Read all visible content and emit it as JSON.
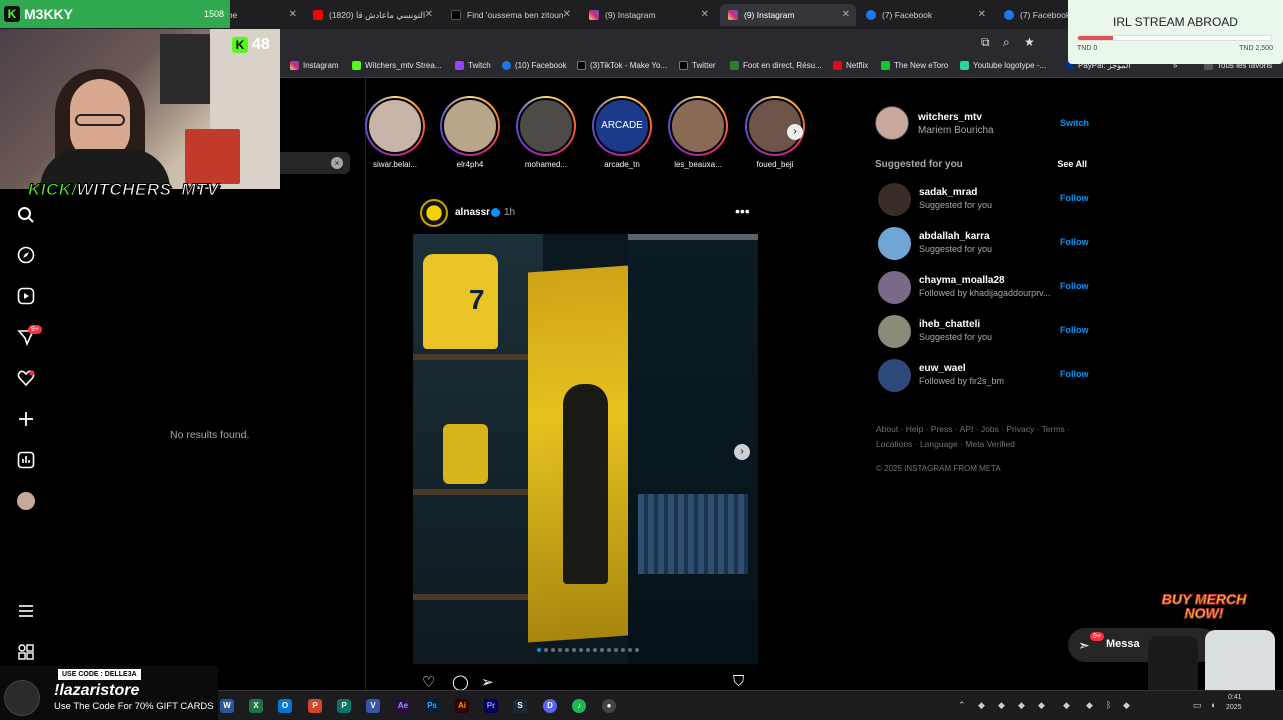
{
  "overlay": {
    "streamer_name": "M3KKY",
    "sub_count": "1508",
    "viewers": "48",
    "kick_logo": "K",
    "kick_handle_prefix": "KICK/",
    "kick_handle": "WITCHERS_MTV"
  },
  "tabs": [
    {
      "label": "ube",
      "active": false
    },
    {
      "label": "(1820) التونسي ماعادش قا",
      "active": false
    },
    {
      "label": "Find 'oussema ben zitoun",
      "active": false
    },
    {
      "label": "(9) Instagram",
      "active": false
    },
    {
      "label": "(9) Instagram",
      "active": true
    },
    {
      "label": "(7) Facebook",
      "active": false
    },
    {
      "label": "(7) Facebook",
      "active": false
    }
  ],
  "bookmarks": [
    "Instagram",
    "Witchers_mtv Strea...",
    "Twitch",
    "(10) Facebook",
    "(3)TikTok - Make Yo...",
    "Twitter",
    "Foot en direct, Résu...",
    "Netflix",
    "The New eToro",
    "Youtube logotype -...",
    "PayPal: الموجز",
    "Tous les favoris"
  ],
  "search": {
    "no_results": "No results found.",
    "clear_icon": "×"
  },
  "nav_badge": "9+",
  "stories": [
    {
      "name": "siwar.belai..."
    },
    {
      "name": "elr4ph4"
    },
    {
      "name": "mohamed..."
    },
    {
      "name": "arcade_tn"
    },
    {
      "name": "les_beauxa..."
    },
    {
      "name": "foued_beji"
    }
  ],
  "arcade_text": "ARCADE",
  "post": {
    "username": "alnassr",
    "time": "1h",
    "more": "•••",
    "jersey_number": "7"
  },
  "me": {
    "username": "witchers_mtv",
    "name": "Mariem Bouricha",
    "switch": "Switch"
  },
  "suggested": {
    "heading": "Suggested for you",
    "see_all": "See All",
    "items": [
      {
        "username": "sadak_mrad",
        "reason": "Suggested for you",
        "action": "Follow"
      },
      {
        "username": "abdallah_karra",
        "reason": "Suggested for you",
        "action": "Follow"
      },
      {
        "username": "chayma_moalla28",
        "reason": "Followed by khadijagaddourprv...",
        "action": "Follow"
      },
      {
        "username": "iheb_chatteli",
        "reason": "Suggested for you",
        "action": "Follow"
      },
      {
        "username": "euw_wael",
        "reason": "Followed by fir2s_bm",
        "action": "Follow"
      }
    ]
  },
  "footer": {
    "links": "About · Help · Press · API · Jobs · Privacy · Terms · Locations · Language · Meta Verified",
    "copyright": "© 2025 INSTAGRAM FROM META"
  },
  "donation": {
    "title": "IRL STREAM ABROAD",
    "min": "TND 0",
    "max": "TND 2,500",
    "progress": 0.18,
    "bar_color": "#e0525a"
  },
  "messages": {
    "label": "Messa",
    "badge": "9+"
  },
  "merch": "BUY MERCH NOW!",
  "promo": {
    "code": "USE CODE : DELLE3A",
    "store": "!lazaristore",
    "sub": "Use The Code For 70% GIFT CARDS"
  },
  "clock": {
    "time": "0:41",
    "date": "2025"
  },
  "icons": {
    "brand_color": "#0095f6",
    "notify_color": "#ff3040",
    "kick_color": "#53fc18"
  }
}
